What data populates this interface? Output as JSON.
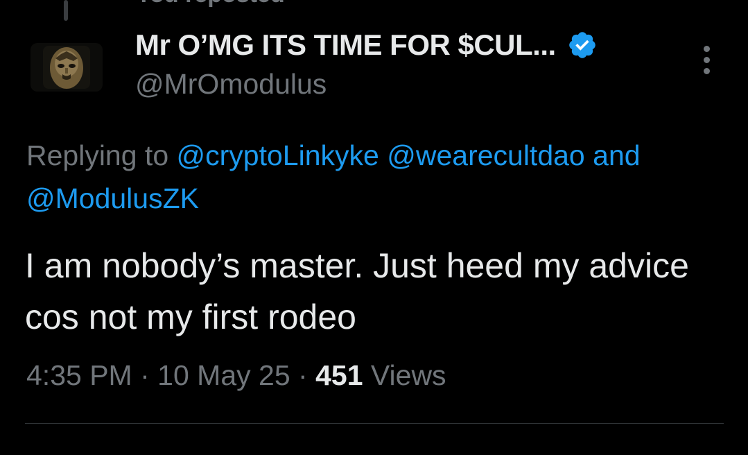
{
  "repost": {
    "label": "You reposted"
  },
  "author": {
    "display_name": "Mr O’MG ITS TIME FOR $CUL...",
    "handle": "@MrOmodulus",
    "verified": true,
    "avatar": "masked-figure-avatar"
  },
  "reply_context": {
    "prefix": "Replying to",
    "mentions": [
      "@cryptoLinkyke",
      "@wearecultdao"
    ],
    "conjunction": "and",
    "last_mention": "@ModulusZK"
  },
  "tweet": {
    "text": "I am nobody’s master. Just heed my advice cos not my first rodeo"
  },
  "meta": {
    "time": "4:35 PM",
    "separator": "·",
    "date": "10 May 25",
    "views_count": "451",
    "views_label": "Views"
  },
  "colors": {
    "background": "#000000",
    "primary_text": "#e7e9ea",
    "secondary_text": "#71767b",
    "link": "#1d9bf0",
    "verified_badge": "#1d9bf0",
    "divider": "#2f3336"
  },
  "icons": {
    "verified": "verified-badge-icon",
    "more": "more-options-icon"
  }
}
